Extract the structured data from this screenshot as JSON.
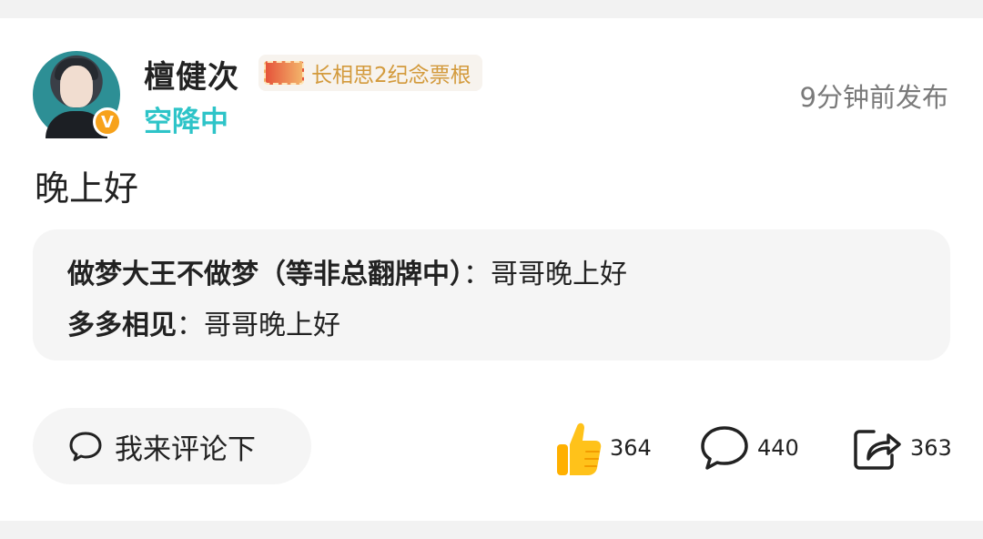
{
  "author": {
    "name": "檀健次",
    "status": "空降中",
    "badge_text": "长相思2纪念票根",
    "verified_mark": "V",
    "avatar_icon": "user-avatar"
  },
  "post": {
    "time": "9分钟前发布",
    "text": "晚上好"
  },
  "replies": [
    {
      "user": "做梦大王不做梦（等非总翻牌中）",
      "separator": "：",
      "text": "哥哥晚上好"
    },
    {
      "user": "多多相见",
      "separator": "：",
      "text": "哥哥晚上好"
    }
  ],
  "actions": {
    "comment_button": "我来评论下",
    "likes": "364",
    "comments": "440",
    "shares": "363"
  },
  "colors": {
    "accent_teal": "#2ec4c8",
    "badge_gold": "#d39a3c",
    "like_yellow": "#ffc21a",
    "verified_orange": "#f7a21b"
  }
}
